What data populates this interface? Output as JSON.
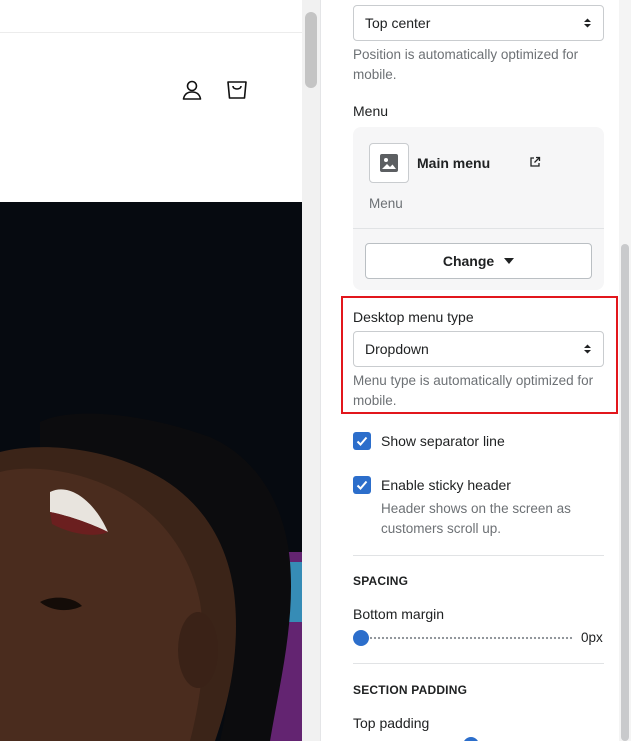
{
  "header_position": {
    "value": "Top center",
    "help": "Position is automatically optimized for mobile."
  },
  "menu": {
    "label": "Menu",
    "name": "Main menu",
    "sub": "Menu",
    "change_label": "Change",
    "icon": "image-icon",
    "external_icon": "external-link-icon"
  },
  "desktop_menu_type": {
    "label": "Desktop menu type",
    "value": "Dropdown",
    "help": "Menu type is automatically optimized for mobile."
  },
  "separator": {
    "label": "Show separator line",
    "checked": true
  },
  "sticky": {
    "label": "Enable sticky header",
    "checked": true,
    "help": "Header shows on the screen as customers scroll up."
  },
  "spacing": {
    "heading": "SPACING",
    "bottom_margin_label": "Bottom margin",
    "bottom_margin_value": "0px"
  },
  "section_padding": {
    "heading": "SECTION PADDING",
    "top_padding_label": "Top padding"
  },
  "preview": {
    "icons": [
      "account-icon",
      "cart-icon"
    ]
  },
  "colors": {
    "accent": "#2c6ecb",
    "highlight": "#e2161c",
    "muted": "#6d7175"
  }
}
